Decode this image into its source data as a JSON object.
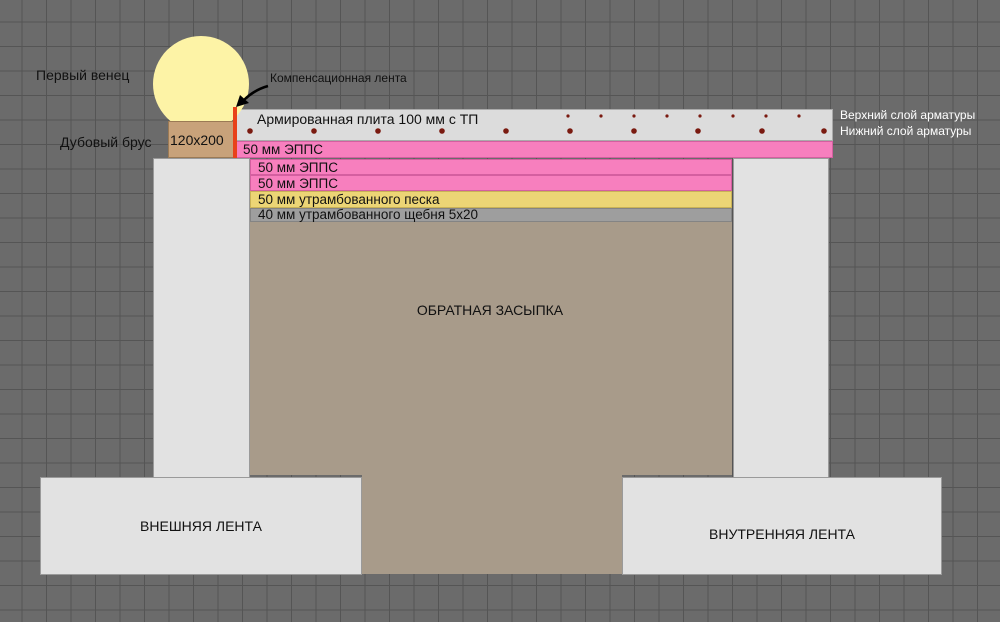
{
  "labels": {
    "first_crown": "Первый венец",
    "oak_beam": "Дубовый брус",
    "beam_size": "120x200",
    "comp_tape": "Компенсационная лента",
    "slab": "Армированная  плита 100 мм с ТП",
    "top_rebar": "Верхний слой арматуры",
    "bottom_rebar": "Нижний слой арматуры",
    "eps1": "50 мм ЭППС",
    "eps2": "50 мм ЭППС",
    "eps3": "50 мм ЭППС",
    "sand": "50 мм утрамбованного песка",
    "gravel": "40 мм утрамбованного щебня 5х20",
    "backfill": "ОБРАТНАЯ ЗАСЫПКА",
    "outer_strip": "ВНЕШНЯЯ ЛЕНТА",
    "inner_strip": "ВНУТРЕННЯЯ ЛЕНТА"
  },
  "colors": {
    "eps": "#f77fbe",
    "sand": "#ecd575",
    "gravel": "#9e9e9e",
    "backfill": "#a89b8a",
    "concrete": "#e2e2e2",
    "crown": "#fdf3a6",
    "beam": "#c8a27a",
    "tape": "#e8421a",
    "rebar": "#7a1a10"
  }
}
